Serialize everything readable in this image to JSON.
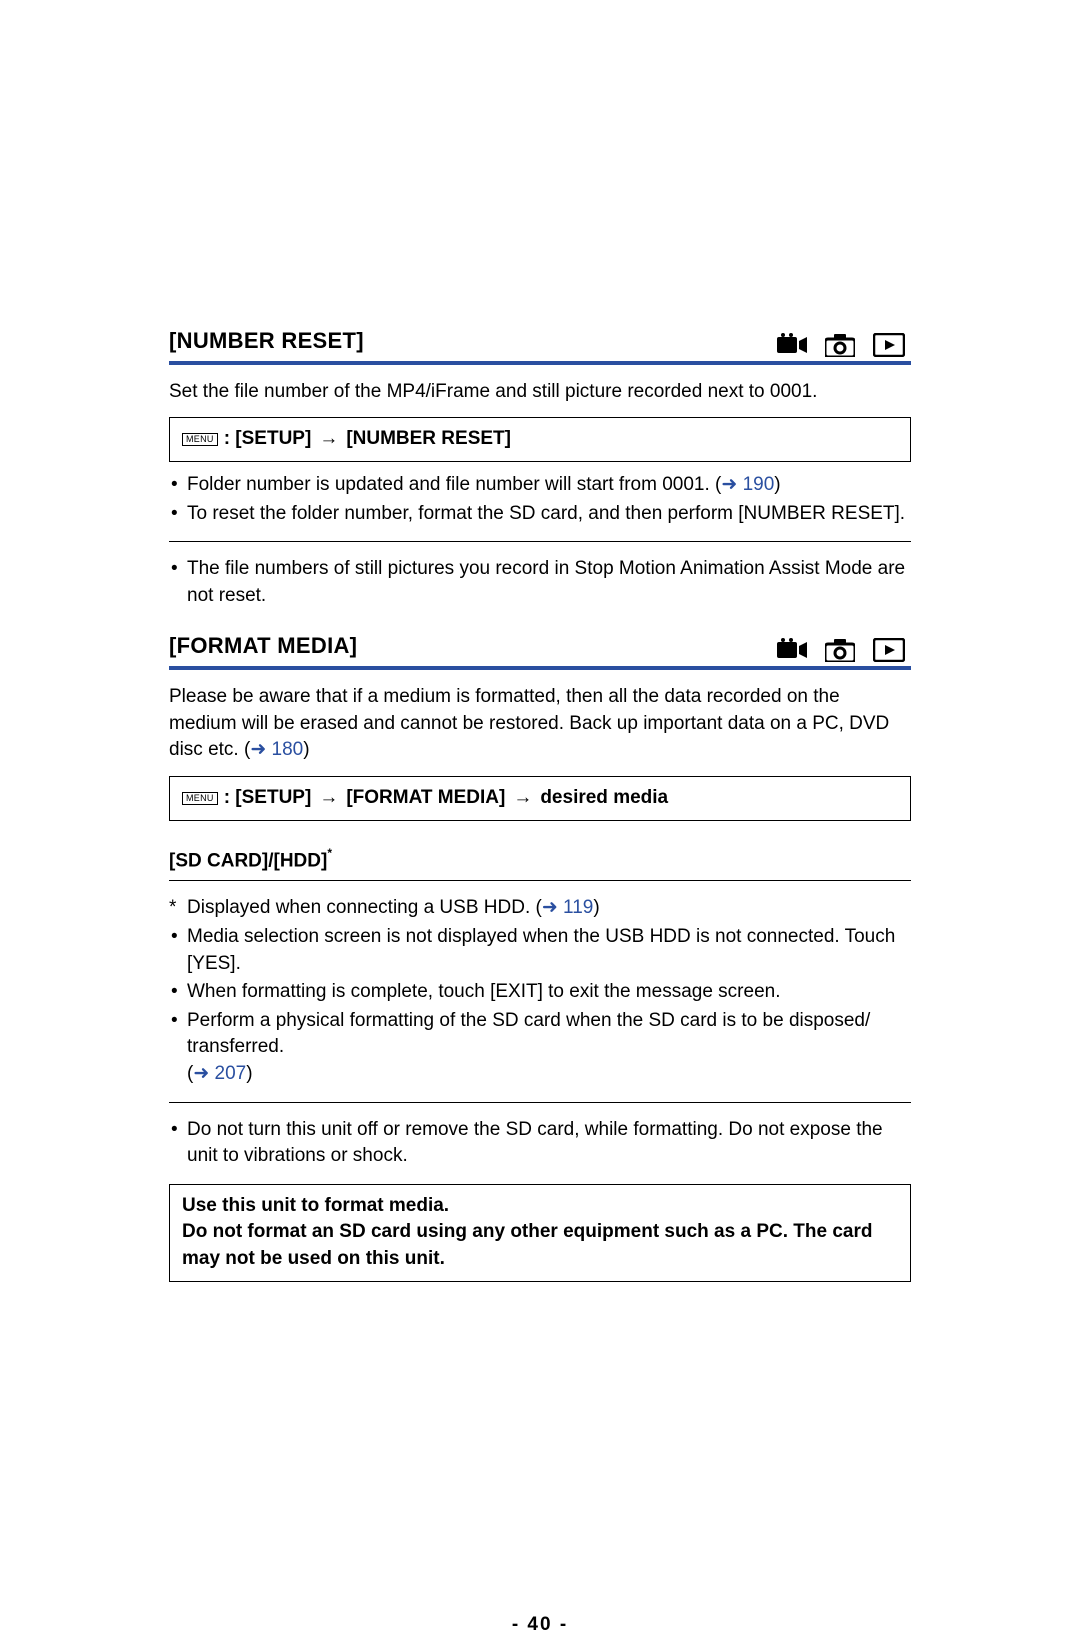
{
  "section1": {
    "title": "[NUMBER RESET]",
    "intro": "Set the file number of the MP4/iFrame and still picture recorded next to 0001.",
    "menu_label": "MENU",
    "menu_path1": ": [SETUP]",
    "menu_path2": "[NUMBER RESET]",
    "b1_a": "Folder number is updated and file number will start from 0001. (",
    "b1_link": "190",
    "b1_b": ")",
    "b2": "To reset the folder number, format the SD card, and then perform [NUMBER RESET].",
    "note": "The file numbers of still pictures you record in Stop Motion Animation Assist Mode are not reset."
  },
  "section2": {
    "title": "[FORMAT MEDIA]",
    "intro_a": "Please be aware that if a medium is formatted, then all the data recorded on the medium will be erased and cannot be restored. Back up important data on a PC, DVD disc etc. (",
    "intro_link": "180",
    "intro_b": ")",
    "menu_label": "MENU",
    "menu_path1": ": [SETUP]",
    "menu_path2": "[FORMAT MEDIA]",
    "menu_path3": "desired media",
    "option_label": "[SD CARD]/[HDD]",
    "option_sup": "*",
    "fn_star": "*",
    "fn1_a": "Displayed when connecting a USB HDD. (",
    "fn1_link": "119",
    "fn1_b": ")",
    "b1": "Media selection screen is not displayed when the USB HDD is not connected. Touch [YES].",
    "b2": "When formatting is complete, touch [EXIT] to exit the message screen.",
    "b3": "Perform a physical formatting of the SD card when the SD card is to be disposed/ transferred. ",
    "b3_link": "207",
    "b3_close": ")",
    "note": "Do not turn this unit off or remove the SD card, while formatting. Do not expose the unit to vibrations or shock.",
    "warn1": "Use this unit to format media.",
    "warn2": "Do not format an SD card using any other equipment such as a PC. The card may not be used on this unit."
  },
  "arrow": "→",
  "link_arrow": "➜",
  "page_number": "- 40 -"
}
